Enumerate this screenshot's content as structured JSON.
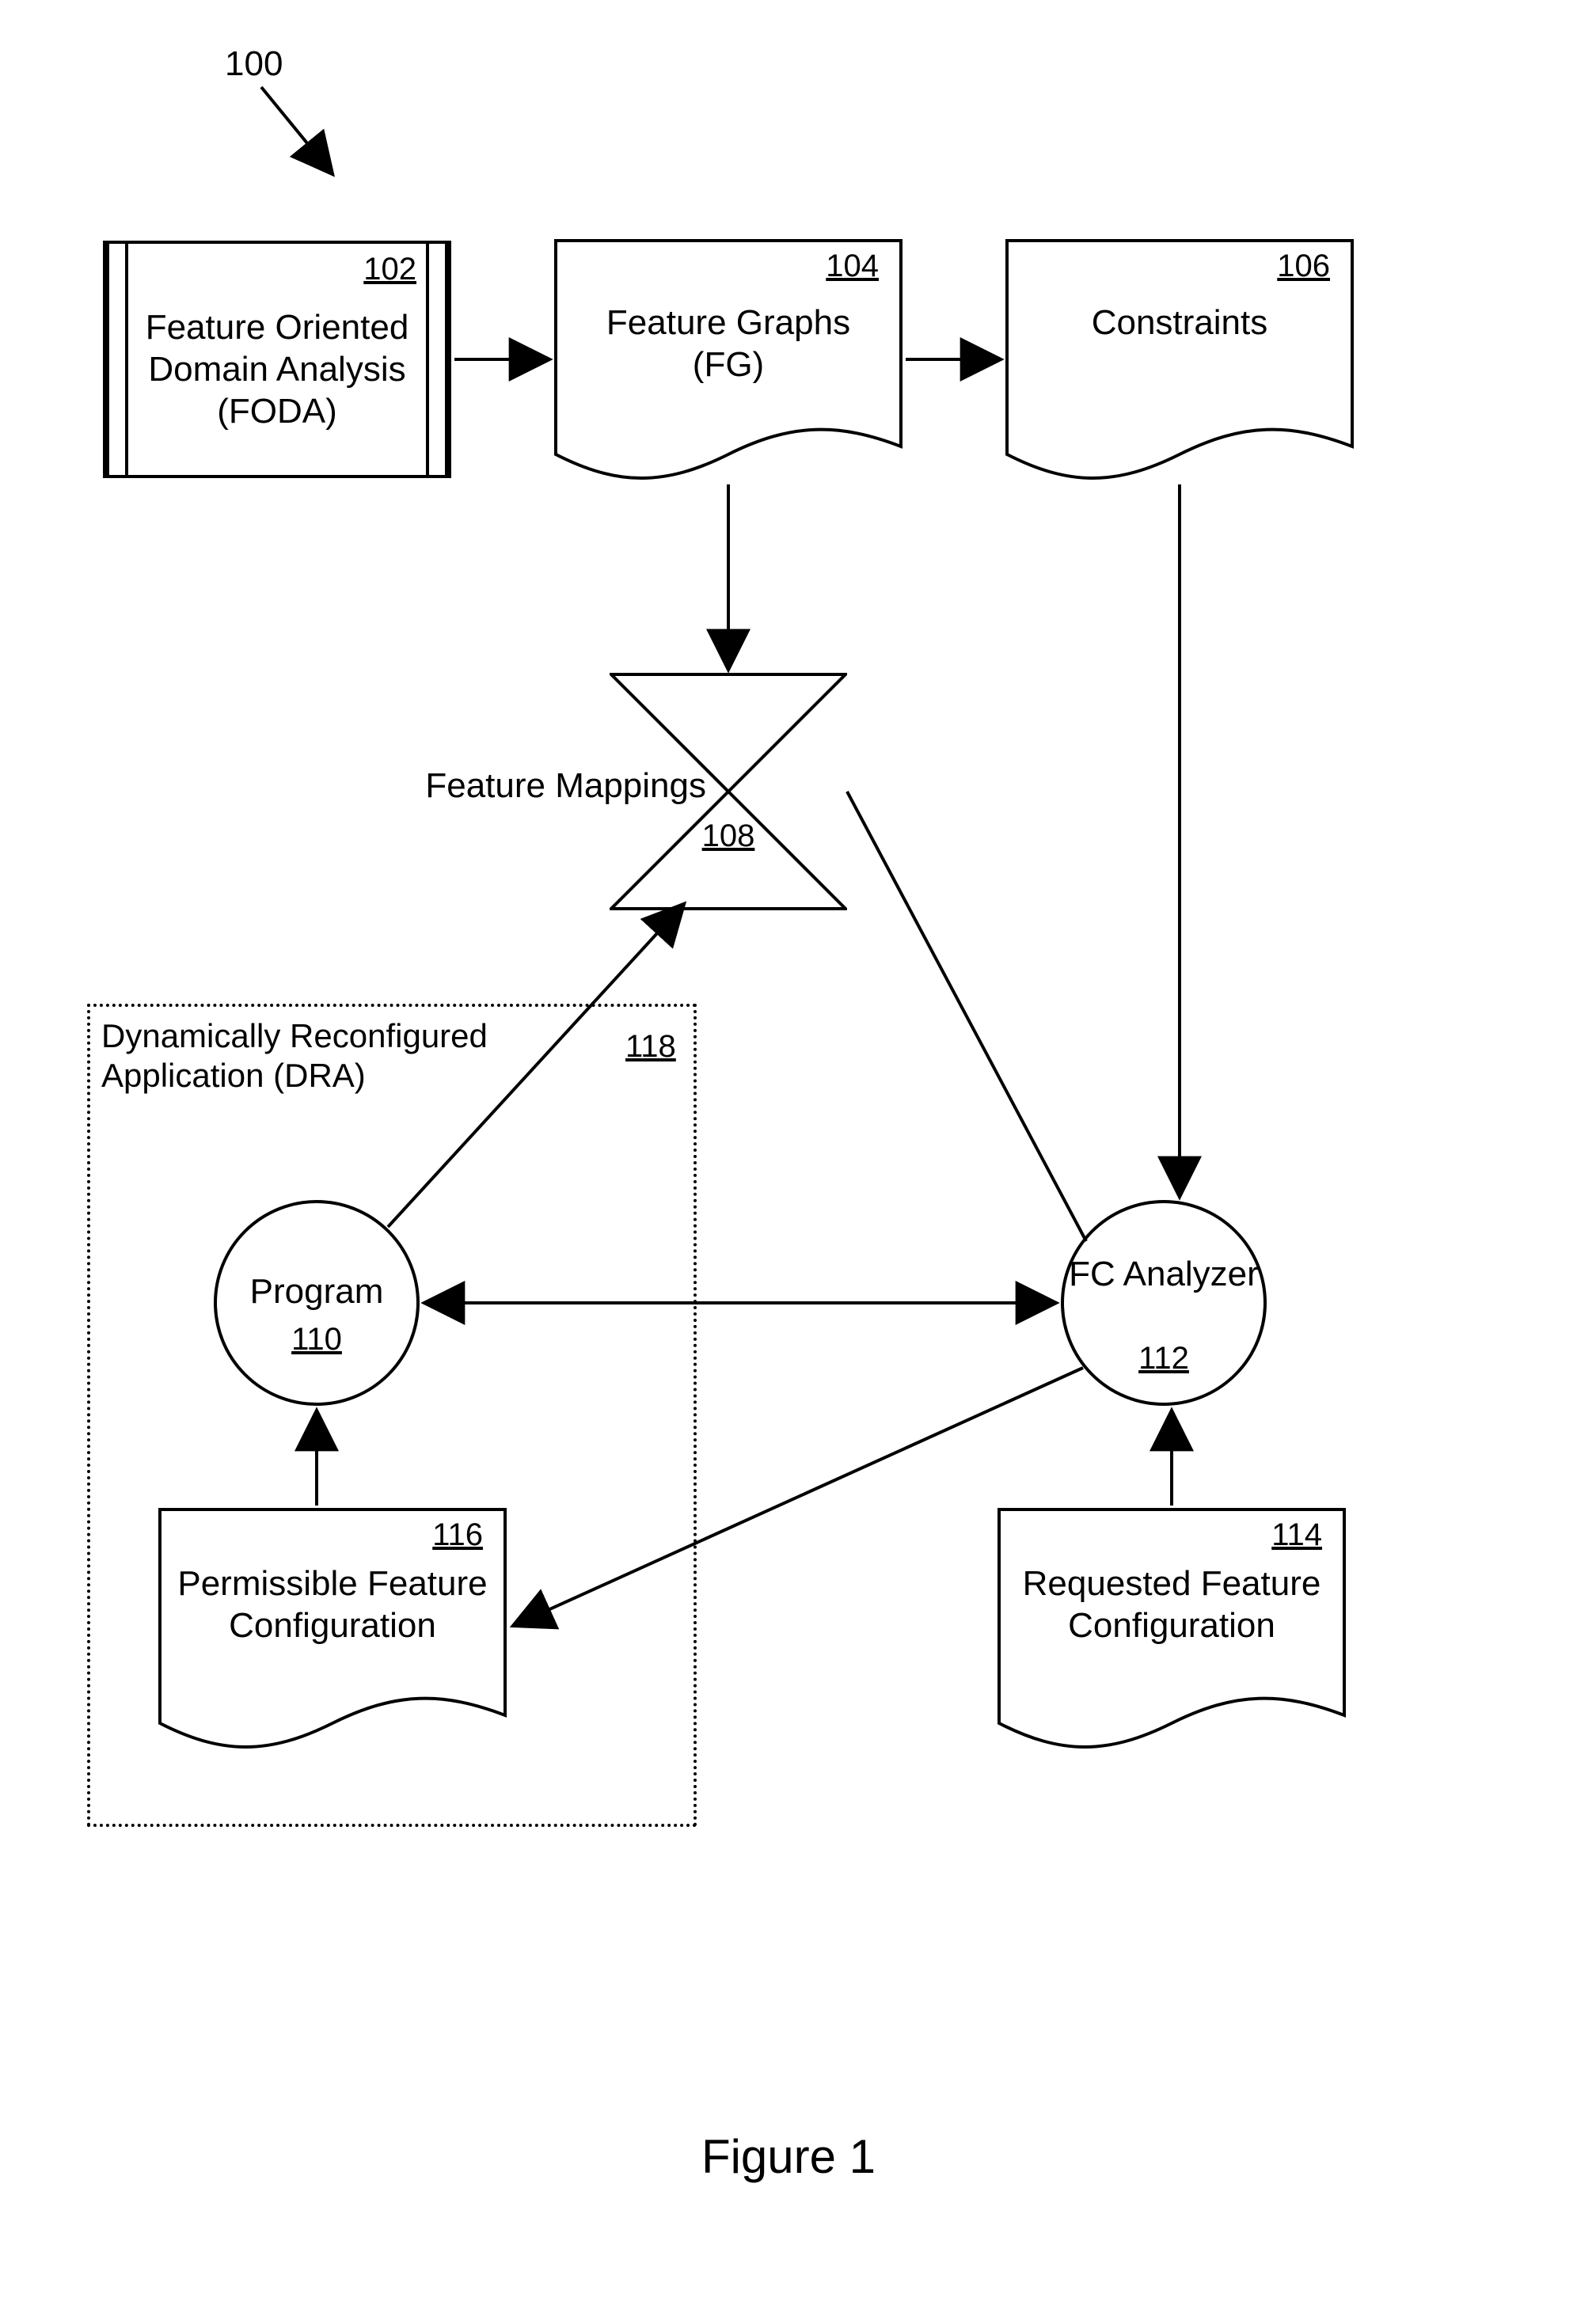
{
  "diagram_ref": "100",
  "caption": "Figure 1",
  "nodes": {
    "foda": {
      "label": "Feature Oriented Domain Analysis (FODA)",
      "ref": "102"
    },
    "fg": {
      "label": "Feature Graphs (FG)",
      "ref": "104"
    },
    "constraints": {
      "label": "Constraints",
      "ref": "106"
    },
    "fmap": {
      "label": "Feature Mappings",
      "ref": "108"
    },
    "program": {
      "label": "Program",
      "ref": "110"
    },
    "fc_analyzer": {
      "label": "FC Analyzer",
      "ref": "112"
    },
    "requested": {
      "label": "Requested Feature Configuration",
      "ref": "114"
    },
    "permissible": {
      "label": "Permissible Feature Configuration",
      "ref": "116"
    },
    "dra": {
      "label": "Dynamically Reconfigured Application (DRA)",
      "ref": "118"
    }
  },
  "chart_data": {
    "type": "diagram",
    "nodes": [
      {
        "id": "102",
        "name": "Feature Oriented Domain Analysis (FODA)",
        "shape": "process-module"
      },
      {
        "id": "104",
        "name": "Feature Graphs (FG)",
        "shape": "document"
      },
      {
        "id": "106",
        "name": "Constraints",
        "shape": "document"
      },
      {
        "id": "108",
        "name": "Feature Mappings",
        "shape": "hourglass"
      },
      {
        "id": "110",
        "name": "Program",
        "shape": "circle"
      },
      {
        "id": "112",
        "name": "FC Analyzer",
        "shape": "circle"
      },
      {
        "id": "114",
        "name": "Requested Feature Configuration",
        "shape": "document"
      },
      {
        "id": "116",
        "name": "Permissible Feature Configuration",
        "shape": "document"
      },
      {
        "id": "118",
        "name": "Dynamically Reconfigured Application (DRA)",
        "shape": "container",
        "contains": [
          "110",
          "116"
        ]
      }
    ],
    "edges": [
      {
        "from": "102",
        "to": "104",
        "directed": true
      },
      {
        "from": "104",
        "to": "106",
        "directed": true
      },
      {
        "from": "104",
        "to": "108",
        "directed": true
      },
      {
        "from": "106",
        "to": "112",
        "directed": true
      },
      {
        "from": "110",
        "to": "108",
        "directed": true
      },
      {
        "from": "108",
        "to": "112",
        "directed": false
      },
      {
        "from": "110",
        "to": "112",
        "directed": true,
        "bidirectional": true
      },
      {
        "from": "114",
        "to": "112",
        "directed": true
      },
      {
        "from": "116",
        "to": "110",
        "directed": true
      },
      {
        "from": "112",
        "to": "116",
        "directed": true
      }
    ]
  }
}
